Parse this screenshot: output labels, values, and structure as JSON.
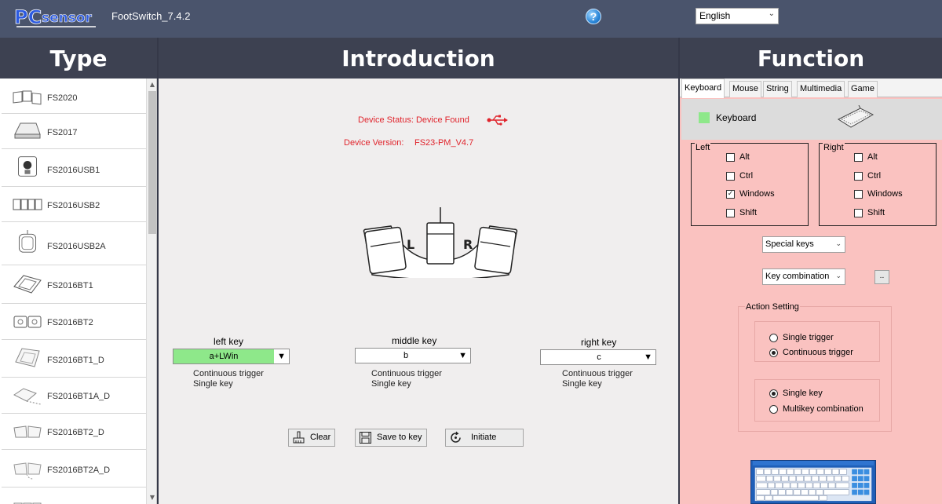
{
  "app": {
    "logo_text": "PCsensor",
    "title": "FootSwitch_7.4.2",
    "help_icon": "question-circle-icon",
    "language": "English"
  },
  "headers": {
    "type": "Type",
    "introduction": "Introduction",
    "function": "Function"
  },
  "sidebar": {
    "items": [
      {
        "label": "FS2020",
        "icon": "triple-pedal-icon"
      },
      {
        "label": "FS2017",
        "icon": "single-pedal-icon"
      },
      {
        "label": "FS2016USB1",
        "icon": "usb-pedal-icon"
      },
      {
        "label": "FS2016USB2",
        "icon": "quad-pedal-icon"
      },
      {
        "label": "FS2016USB2A",
        "icon": "pedal-cable-icon"
      },
      {
        "label": "FS2016BT1",
        "icon": "bt-pedal-icon"
      },
      {
        "label": "FS2016BT2",
        "icon": "dual-pedal-icon"
      },
      {
        "label": "FS2016BT1_D",
        "icon": "single-pedal-outline-icon"
      },
      {
        "label": "FS2016BT1A_D",
        "icon": "pedal-cable-outline-icon"
      },
      {
        "label": "FS2016BT2_D",
        "icon": "dual-pedal-outline-icon"
      },
      {
        "label": "FS2016BT2A_D",
        "icon": "dual-pedal-cable-icon"
      },
      {
        "label": "",
        "icon": "pedal-partial-icon"
      }
    ]
  },
  "intro": {
    "device_status": "Device Status: Device Found",
    "device_version_label": "Device Version:",
    "device_version_value": "FS23-PM_V4.7",
    "status_color": "#e0242c",
    "keys": {
      "left": {
        "label": "left key",
        "value": "a+LWin",
        "hint1": "Continuous trigger",
        "hint2": "Single key"
      },
      "middle": {
        "label": "middle key",
        "value": "b",
        "hint1": "Continuous trigger",
        "hint2": "Single key"
      },
      "right": {
        "label": "right key",
        "value": "c",
        "hint1": "Continuous trigger",
        "hint2": "Single key"
      }
    },
    "buttons": {
      "clear": "Clear",
      "save": "Save to key",
      "initiate": "Initiate"
    }
  },
  "function": {
    "tabs": [
      "Keyboard",
      "Mouse",
      "String",
      "Multimedia",
      "Game"
    ],
    "active_tab": "Keyboard",
    "keyboard_label": "Keyboard",
    "keyboard_swatch_color": "#8ee88a",
    "left": {
      "title": "Left",
      "options": [
        {
          "label": "Alt",
          "checked": false
        },
        {
          "label": "Ctrl",
          "checked": false
        },
        {
          "label": "Windows",
          "checked": true
        },
        {
          "label": "Shift",
          "checked": false
        }
      ]
    },
    "right": {
      "title": "Right",
      "options": [
        {
          "label": "Alt",
          "checked": false
        },
        {
          "label": "Ctrl",
          "checked": false
        },
        {
          "label": "Windows",
          "checked": false
        },
        {
          "label": "Shift",
          "checked": false
        }
      ]
    },
    "special_keys": "Special keys",
    "key_combination": "Key combination",
    "dots_button": "..",
    "action_setting": {
      "title": "Action Setting",
      "trigger": [
        {
          "label": "Single trigger",
          "selected": false
        },
        {
          "label": "Continuous trigger",
          "selected": true
        }
      ],
      "key_mode": [
        {
          "label": "Single key",
          "selected": true
        },
        {
          "label": "Multikey  combination",
          "selected": false
        }
      ]
    },
    "panel_color": "#fac2c0"
  }
}
